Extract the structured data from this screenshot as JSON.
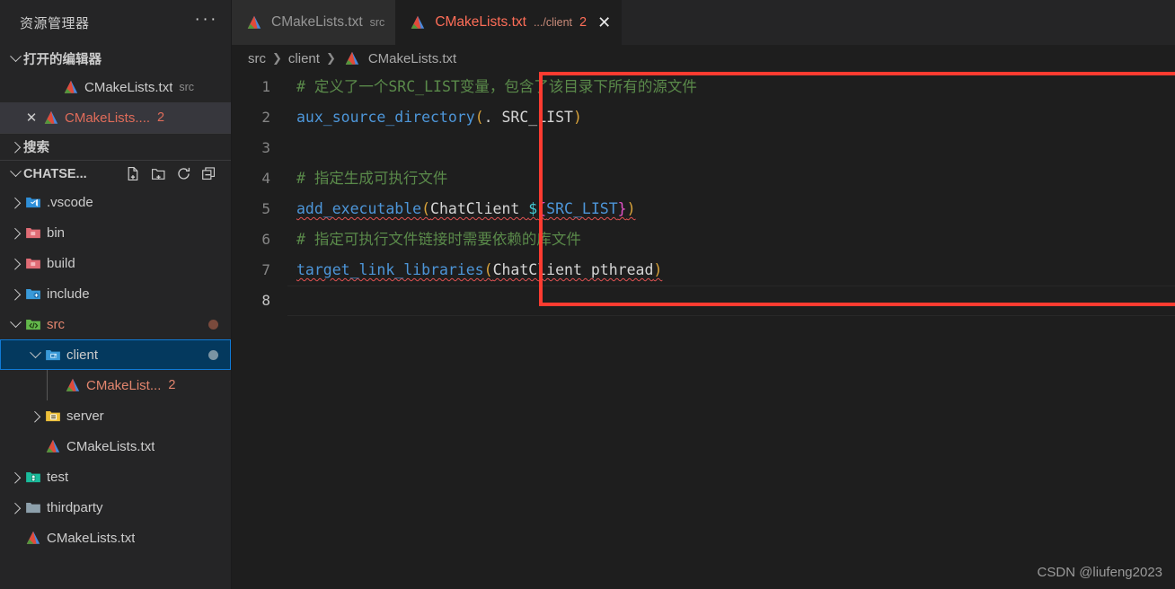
{
  "sidebar": {
    "title": "资源管理器",
    "more_label": "···",
    "open_editors": {
      "label": "打开的编辑器",
      "items": [
        {
          "name": "CMakeLists.txt",
          "suffix": "src",
          "badge": "",
          "modified": false,
          "selected": false,
          "close": false
        },
        {
          "name": "CMakeLists....",
          "suffix": "",
          "badge": "2",
          "modified": true,
          "selected": true,
          "close": true
        }
      ]
    },
    "search": {
      "label": "搜索"
    },
    "project": {
      "label": "CHATSE...",
      "actions": [
        "new-file",
        "new-folder",
        "refresh",
        "collapse-all"
      ],
      "tree": [
        {
          "label": ".vscode",
          "icon": "vscode-folder",
          "twisty": "right",
          "depth": 1,
          "modified": false,
          "badge": "",
          "selected": false,
          "dot": ""
        },
        {
          "label": "bin",
          "icon": "red-folder",
          "twisty": "right",
          "depth": 1,
          "modified": false,
          "badge": "",
          "selected": false,
          "dot": ""
        },
        {
          "label": "build",
          "icon": "red-folder",
          "twisty": "right",
          "depth": 1,
          "modified": false,
          "badge": "",
          "selected": false,
          "dot": ""
        },
        {
          "label": "include",
          "icon": "include-folder",
          "twisty": "right",
          "depth": 1,
          "modified": false,
          "badge": "",
          "selected": false,
          "dot": ""
        },
        {
          "label": "src",
          "icon": "src-folder",
          "twisty": "down",
          "depth": 1,
          "modified": true,
          "badge": "",
          "selected": false,
          "dot": "#7a4a3c"
        },
        {
          "label": "client",
          "icon": "client-folder",
          "twisty": "down",
          "depth": 2,
          "modified": false,
          "badge": "",
          "selected": true,
          "dot": "#7b94a3"
        },
        {
          "label": "CMakeList...",
          "icon": "cmake-file",
          "twisty": "none",
          "depth": 3,
          "modified": true,
          "badge": "2",
          "selected": false,
          "dot": ""
        },
        {
          "label": "server",
          "icon": "server-folder",
          "twisty": "right",
          "depth": 2,
          "modified": false,
          "badge": "",
          "selected": false,
          "dot": ""
        },
        {
          "label": "CMakeLists.txt",
          "icon": "cmake-file",
          "twisty": "none",
          "depth": 2,
          "modified": false,
          "badge": "",
          "selected": false,
          "dot": ""
        },
        {
          "label": "test",
          "icon": "test-folder",
          "twisty": "right",
          "depth": 1,
          "modified": false,
          "badge": "",
          "selected": false,
          "dot": ""
        },
        {
          "label": "thirdparty",
          "icon": "grey-folder",
          "twisty": "right",
          "depth": 1,
          "modified": false,
          "badge": "",
          "selected": false,
          "dot": ""
        },
        {
          "label": "CMakeLists.txt",
          "icon": "cmake-file",
          "twisty": "none",
          "depth": 1,
          "modified": false,
          "badge": "",
          "selected": false,
          "dot": ""
        }
      ]
    }
  },
  "tabs": [
    {
      "name": "CMakeLists.txt",
      "dir": "src",
      "badge": "",
      "active": false,
      "close": false
    },
    {
      "name": "CMakeLists.txt",
      "dir": ".../client",
      "badge": "2",
      "active": true,
      "close": true
    }
  ],
  "breadcrumb": {
    "parts": [
      "src",
      "client",
      "CMakeLists.txt"
    ],
    "separator": "❯"
  },
  "editor": {
    "language": "cmake",
    "current_line": 8,
    "lines": [
      {
        "n": "1",
        "tokens": [
          {
            "t": "# 定义了一个SRC_LIST变量，包含了该目录下所有的源文件",
            "c": "t-com"
          }
        ]
      },
      {
        "n": "2",
        "tokens": [
          {
            "t": "aux_source_directory",
            "c": "t-fn"
          },
          {
            "t": "(",
            "c": "t-par"
          },
          {
            "t": ". ",
            "c": "t-txt"
          },
          {
            "t": "SRC_LIST",
            "c": "t-txt"
          },
          {
            "t": ")",
            "c": "t-par"
          }
        ]
      },
      {
        "n": "3",
        "tokens": []
      },
      {
        "n": "4",
        "tokens": [
          {
            "t": "# 指定生成可执行文件",
            "c": "t-com"
          }
        ]
      },
      {
        "n": "5",
        "tokens": [
          {
            "t": "add_executable",
            "c": "t-fn squig"
          },
          {
            "t": "(",
            "c": "t-par squig"
          },
          {
            "t": "ChatClient ",
            "c": "t-txt squig"
          },
          {
            "t": "$",
            "c": "t-dol squig"
          },
          {
            "t": "{",
            "c": "t-brc squig"
          },
          {
            "t": "SRC_LIST",
            "c": "t-var squig"
          },
          {
            "t": "}",
            "c": "t-brc squig"
          },
          {
            "t": ")",
            "c": "t-par squig"
          }
        ]
      },
      {
        "n": "6",
        "tokens": [
          {
            "t": "# 指定可执行文件链接时需要依赖的库文件",
            "c": "t-com"
          }
        ]
      },
      {
        "n": "7",
        "tokens": [
          {
            "t": "target_link_libraries",
            "c": "t-fn squig"
          },
          {
            "t": "(",
            "c": "t-par squig"
          },
          {
            "t": "ChatClient pthread",
            "c": "t-txt squig"
          },
          {
            "t": ")",
            "c": "t-par squig"
          }
        ]
      },
      {
        "n": "8",
        "tokens": []
      }
    ]
  },
  "annotation": {
    "highlight_color": "#ff3b30",
    "shape": "rectangle"
  },
  "watermark": {
    "text": "CSDN @liufeng2023"
  }
}
